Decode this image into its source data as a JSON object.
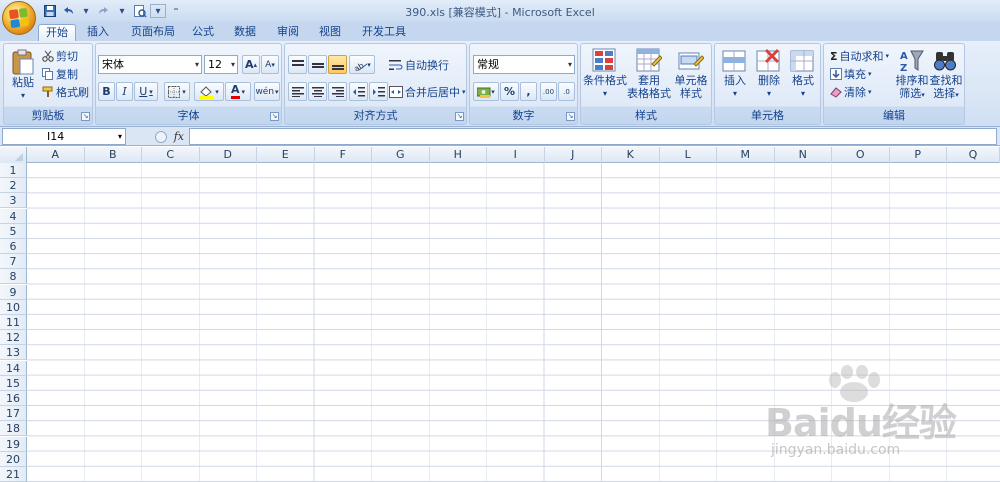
{
  "window": {
    "title": "390.xls  [兼容模式] - Microsoft Excel"
  },
  "tabs": [
    {
      "label": "开始",
      "active": true
    },
    {
      "label": "插入"
    },
    {
      "label": "页面布局"
    },
    {
      "label": "公式"
    },
    {
      "label": "数据"
    },
    {
      "label": "审阅"
    },
    {
      "label": "视图"
    },
    {
      "label": "开发工具"
    }
  ],
  "ribbon": {
    "clipboard": {
      "group_label": "剪贴板",
      "paste": "粘贴",
      "cut": "剪切",
      "copy": "复制",
      "format_painter": "格式刷"
    },
    "font": {
      "group_label": "字体",
      "font_name": "宋体",
      "font_size": "12",
      "grow": "A",
      "shrink": "A",
      "bold": "B",
      "italic": "I",
      "underline": "U",
      "font_color": "A",
      "phonetic": "wén"
    },
    "alignment": {
      "group_label": "对齐方式",
      "wrap_text": "自动换行",
      "merge_center": "合并后居中"
    },
    "number": {
      "group_label": "数字",
      "format": "常规",
      "percent": "%",
      "comma": ",",
      "inc_decimal": ".00",
      "dec_decimal": ".0"
    },
    "styles": {
      "group_label": "样式",
      "conditional": "条件格式",
      "table_line1": "套用",
      "table_line2": "表格格式",
      "cell_line1": "单元格",
      "cell_line2": "样式"
    },
    "cells": {
      "group_label": "单元格",
      "insert": "插入",
      "delete": "删除",
      "format": "格式"
    },
    "editing": {
      "group_label": "编辑",
      "sigma": "Σ",
      "autosum": "自动求和",
      "fill": "填充",
      "clear": "清除",
      "sort_line1": "排序和",
      "sort_line2": "筛选",
      "find_line1": "查找和",
      "find_line2": "选择"
    }
  },
  "formula_bar": {
    "name_box": "I14",
    "fx": "fx",
    "formula": ""
  },
  "sheet": {
    "columns": [
      "A",
      "B",
      "C",
      "D",
      "E",
      "F",
      "G",
      "H",
      "I",
      "J",
      "K",
      "L",
      "M",
      "N",
      "O",
      "P",
      "Q"
    ],
    "rows": [
      "1",
      "2",
      "3",
      "4",
      "5",
      "6",
      "7",
      "8",
      "9",
      "10",
      "11",
      "12",
      "13",
      "14",
      "15",
      "16",
      "17",
      "18",
      "19",
      "20",
      "21"
    ]
  },
  "watermark": {
    "brand": "Baidu经验",
    "url": "jingyan.baidu.com"
  },
  "colors": {
    "ribbon_bg": "#dbe7f6",
    "tab_text": "#15428b",
    "grid_line": "#d0d7e5"
  }
}
